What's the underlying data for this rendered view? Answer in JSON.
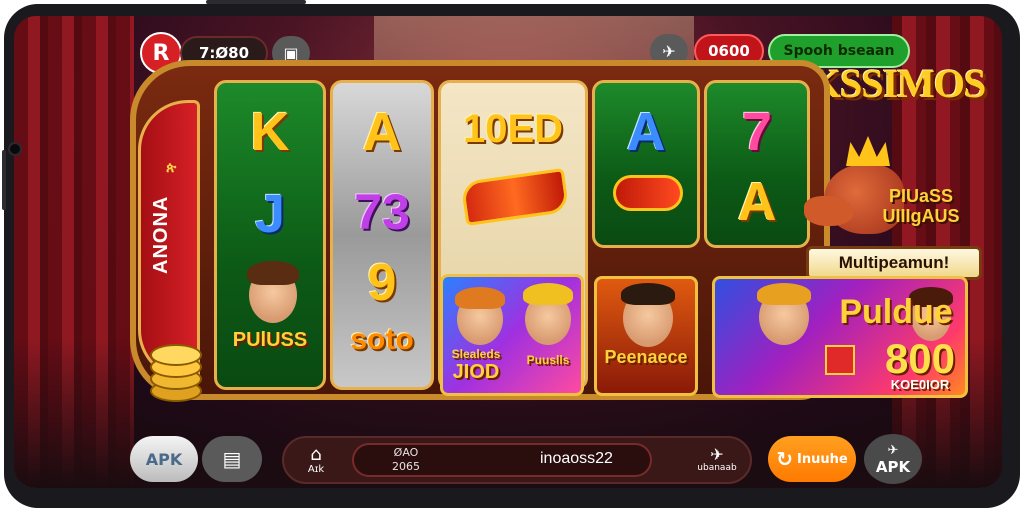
{
  "top_bar": {
    "brand_glyph": "R",
    "balance": "7:Ø80",
    "wallet_icon": "wallet-icon",
    "plane_icon": "plane-icon",
    "credits": "0600",
    "promo_button": "Spooh bseaan"
  },
  "logo": {
    "text": "KSSIMOS"
  },
  "machine": {
    "side_label": "ANONA",
    "side_mark": "ጵ",
    "reels": [
      {
        "symbols": [
          "K",
          "J"
        ]
      },
      {
        "symbols": [
          "A",
          "73",
          "9",
          "soto"
        ]
      },
      {
        "symbols": [
          "10ED"
        ]
      },
      {
        "symbols": [
          "A"
        ]
      },
      {
        "symbols": [
          "7",
          "A"
        ]
      }
    ],
    "card_labels": [
      "PUlUSS"
    ],
    "cards": [
      {
        "line1": "Slealeds",
        "line2": "JIOD"
      },
      {
        "line1": "Puuslls",
        "line2": ""
      },
      {
        "line1": "Peenaece",
        "line2": ""
      }
    ]
  },
  "right_panel": {
    "mascot_label": "PIUaSS\nUIIIgAUS",
    "banner": "Multipeamun!",
    "promo_title": "Puldue",
    "promo_value": "800",
    "promo_sub": "KOE0IOR"
  },
  "bottom_bar": {
    "apk_left": "APK",
    "clipboard_icon": "clipboard-icon",
    "home_label": "A͏ɪk",
    "stat_label": "ØAO",
    "stat_value": "2065",
    "center_text": "inoaoss22",
    "right_label": "ubanaab",
    "action_button": "Inuuhe",
    "apk_right": "APK"
  },
  "colors": {
    "red": "#d62026",
    "green": "#1fa02c",
    "orange": "#ff8a00",
    "gold": "#ffc31a",
    "dark": "#1a1a1e"
  }
}
